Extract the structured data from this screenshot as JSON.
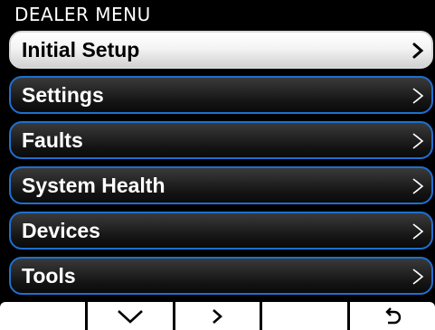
{
  "header": {
    "title": "DEALER MENU"
  },
  "menu": {
    "items": [
      {
        "label": "Initial Setup",
        "icon": "chevron-right-icon",
        "selected": true
      },
      {
        "label": "Settings",
        "icon": "chevron-right-icon",
        "selected": false
      },
      {
        "label": "Faults",
        "icon": "chevron-right-icon",
        "selected": false
      },
      {
        "label": "System Health",
        "icon": "chevron-right-icon",
        "selected": false
      },
      {
        "label": "Devices",
        "icon": "chevron-right-icon",
        "selected": false
      },
      {
        "label": "Tools",
        "icon": "chevron-right-icon",
        "selected": false
      }
    ]
  },
  "footer": {
    "buttons": [
      {
        "icon": "none"
      },
      {
        "icon": "chevron-down-icon"
      },
      {
        "icon": "chevron-right-icon"
      },
      {
        "icon": "none"
      },
      {
        "icon": "back-arrow-icon"
      }
    ]
  },
  "colors": {
    "item_border": "#1f6fd0",
    "selected_bg": "#ffffff",
    "item_bg": "#2a2a2a",
    "screen_bg": "#000000"
  }
}
